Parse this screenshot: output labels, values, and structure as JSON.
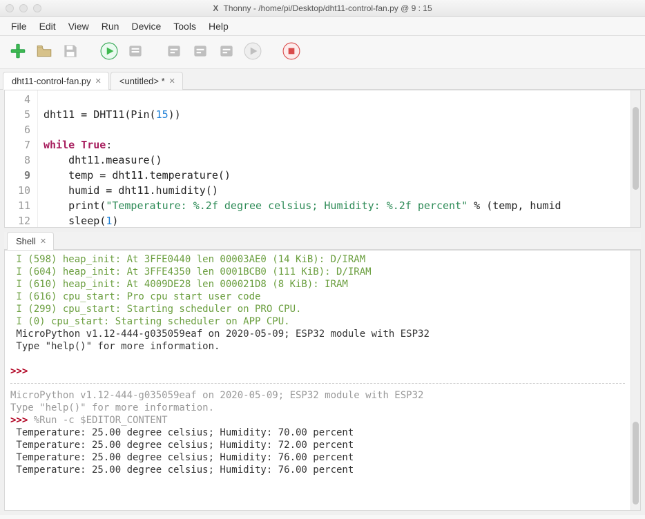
{
  "window": {
    "app": "Thonny",
    "path": "/home/pi/Desktop/dht11-control-fan.py",
    "cursor": "9 : 15",
    "title_full": "Thonny  -  /home/pi/Desktop/dht11-control-fan.py  @  9 : 15"
  },
  "menu": [
    "File",
    "Edit",
    "View",
    "Run",
    "Device",
    "Tools",
    "Help"
  ],
  "toolbar": {
    "buttons": [
      {
        "name": "new-file-button",
        "icon": "plus-green"
      },
      {
        "name": "open-file-button",
        "icon": "folder-open"
      },
      {
        "name": "save-file-button",
        "icon": "save-gray"
      },
      {
        "name": "spacer"
      },
      {
        "name": "run-button",
        "icon": "play-green"
      },
      {
        "name": "debug-button",
        "icon": "bug-gray"
      },
      {
        "name": "spacer"
      },
      {
        "name": "step-over-button",
        "icon": "step-over-gray"
      },
      {
        "name": "step-into-button",
        "icon": "step-into-gray"
      },
      {
        "name": "step-out-button",
        "icon": "step-out-gray"
      },
      {
        "name": "resume-button",
        "icon": "resume-gray"
      },
      {
        "name": "spacer"
      },
      {
        "name": "stop-button",
        "icon": "stop-red"
      }
    ]
  },
  "tabs": [
    {
      "label": "dht11-control-fan.py",
      "active": true,
      "closable": true
    },
    {
      "label": "<untitled> *",
      "active": false,
      "closable": true
    }
  ],
  "editor": {
    "first_line_no": 4,
    "cursor_line": 9,
    "lines": [
      {
        "no": 4,
        "segments": []
      },
      {
        "no": 5,
        "segments": [
          {
            "t": "dht11 = DHT11(Pin("
          },
          {
            "t": "15",
            "cls": "tok-num"
          },
          {
            "t": "))"
          }
        ]
      },
      {
        "no": 6,
        "segments": []
      },
      {
        "no": 7,
        "segments": [
          {
            "t": "while ",
            "cls": "tok-kw"
          },
          {
            "t": "True",
            "cls": "tok-bool"
          },
          {
            "t": ":"
          }
        ]
      },
      {
        "no": 8,
        "segments": [
          {
            "t": "    dht11.measure()"
          }
        ]
      },
      {
        "no": 9,
        "segments": [
          {
            "t": "    temp = dht11.temperature()"
          }
        ]
      },
      {
        "no": 10,
        "segments": [
          {
            "t": "    humid = dht11.humidity()"
          }
        ]
      },
      {
        "no": 11,
        "segments": [
          {
            "t": "    "
          },
          {
            "t": "print",
            "cls": "tok-fn"
          },
          {
            "t": "("
          },
          {
            "t": "\"Temperature: %.2f degree celsius; Humidity: %.2f percent\"",
            "cls": "tok-str"
          },
          {
            "t": " % (temp, humid"
          }
        ]
      },
      {
        "no": 12,
        "segments": [
          {
            "t": "    sleep("
          },
          {
            "t": "1",
            "cls": "tok-num"
          },
          {
            "t": ")"
          }
        ]
      }
    ]
  },
  "shell": {
    "tab_label": "Shell",
    "boot_lines": [
      "I (598) heap_init: At 3FFE0440 len 00003AE0 (14 KiB): D/IRAM",
      "I (604) heap_init: At 3FFE4350 len 0001BCB0 (111 KiB): D/IRAM",
      "I (610) heap_init: At 4009DE28 len 000021D8 (8 KiB): IRAM",
      "I (616) cpu_start: Pro cpu start user code",
      "I (299) cpu_start: Starting scheduler on PRO CPU.",
      "I (0) cpu_start: Starting scheduler on APP CPU."
    ],
    "sys_lines": [
      " MicroPython v1.12-444-g035059eaf on 2020-05-09; ESP32 module with ESP32",
      " Type \"help()\" for more information."
    ],
    "prompt": ">>> ",
    "gray_lines": [
      "MicroPython v1.12-444-g035059eaf on 2020-05-09; ESP32 module with ESP32",
      "Type \"help()\" for more information."
    ],
    "run_prompt": ">>> ",
    "run_cmd": "%Run -c $EDITOR_CONTENT",
    "output_lines": [
      " Temperature: 25.00 degree celsius; Humidity: 70.00 percent",
      " Temperature: 25.00 degree celsius; Humidity: 72.00 percent",
      " Temperature: 25.00 degree celsius; Humidity: 76.00 percent",
      " Temperature: 25.00 degree celsius; Humidity: 76.00 percent"
    ]
  }
}
